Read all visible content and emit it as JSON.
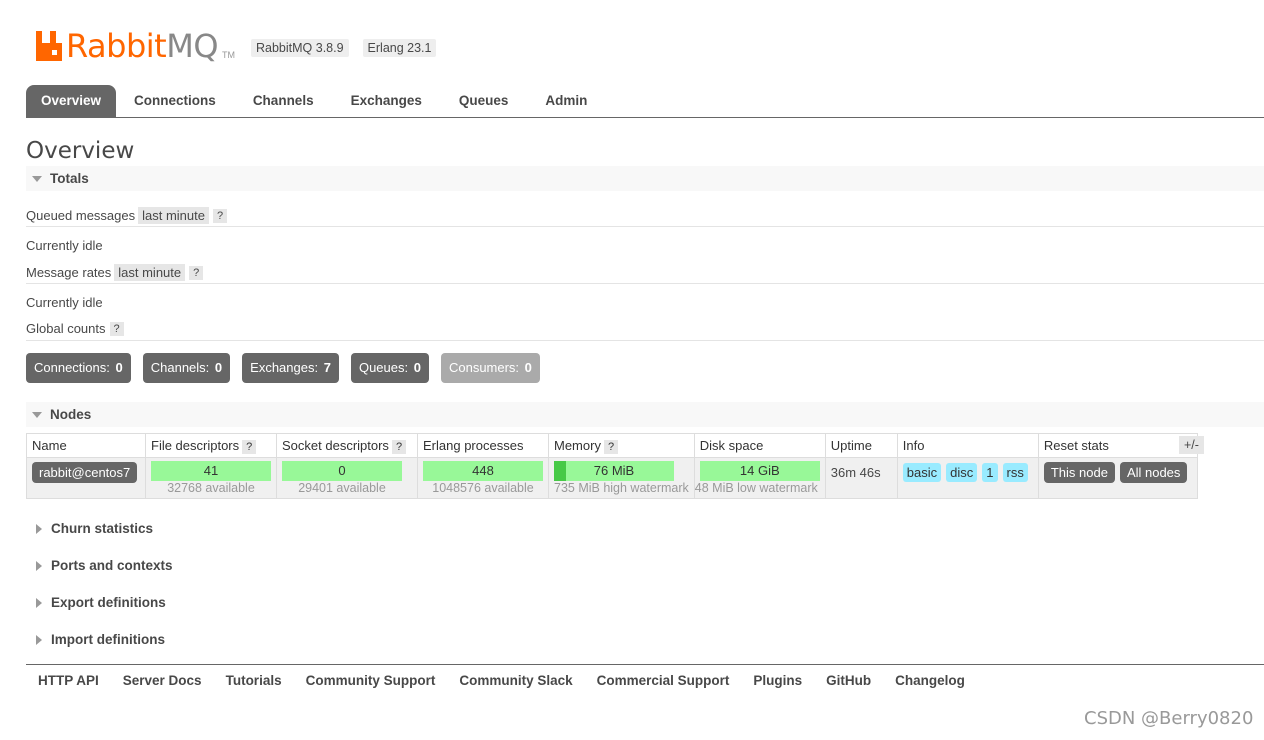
{
  "header": {
    "logo_rabbit": "Rabbit",
    "logo_mq": "MQ",
    "logo_tm": "TM",
    "rabbitmq_version": "RabbitMQ 3.8.9",
    "erlang_version": "Erlang 23.1"
  },
  "tabs": [
    {
      "label": "Overview",
      "active": true
    },
    {
      "label": "Connections"
    },
    {
      "label": "Channels"
    },
    {
      "label": "Exchanges"
    },
    {
      "label": "Queues"
    },
    {
      "label": "Admin"
    }
  ],
  "page_title": "Overview",
  "totals": {
    "heading": "Totals",
    "queued_label": "Queued messages",
    "queued_range": "last minute",
    "help": "?",
    "queued_status": "Currently idle",
    "rates_label": "Message rates",
    "rates_range": "last minute",
    "rates_status": "Currently idle",
    "global_label": "Global counts"
  },
  "counts": [
    {
      "label": "Connections:",
      "value": "0"
    },
    {
      "label": "Channels:",
      "value": "0"
    },
    {
      "label": "Exchanges:",
      "value": "7"
    },
    {
      "label": "Queues:",
      "value": "0"
    },
    {
      "label": "Consumers:",
      "value": "0"
    }
  ],
  "nodes": {
    "heading": "Nodes",
    "columns": [
      "Name",
      "File descriptors",
      "Socket descriptors",
      "Erlang processes",
      "Memory",
      "Disk space",
      "Uptime",
      "Info",
      "Reset stats"
    ],
    "toggle": "+/-",
    "row": {
      "name": "rabbit@centos7",
      "file_descriptors": "41",
      "file_available": "32768 available",
      "socket_descriptors": "0",
      "socket_available": "29401 available",
      "erlang_processes": "448",
      "erlang_available": "1048576 available",
      "memory": "76 MiB",
      "memory_watermark": "735 MiB high watermark",
      "memory_fraction": 0.1,
      "disk": "14 GiB",
      "disk_watermark": "48 MiB low watermark",
      "uptime": "36m 46s",
      "info": [
        "basic",
        "disc",
        "1",
        "rss"
      ],
      "reset_this": "This node",
      "reset_all": "All nodes"
    }
  },
  "collapsed_sections": [
    "Churn statistics",
    "Ports and contexts",
    "Export definitions",
    "Import definitions"
  ],
  "footer": [
    "HTTP API",
    "Server Docs",
    "Tutorials",
    "Community Support",
    "Community Slack",
    "Commercial Support",
    "Plugins",
    "GitHub",
    "Changelog"
  ],
  "watermark": "CSDN @Berry0820"
}
